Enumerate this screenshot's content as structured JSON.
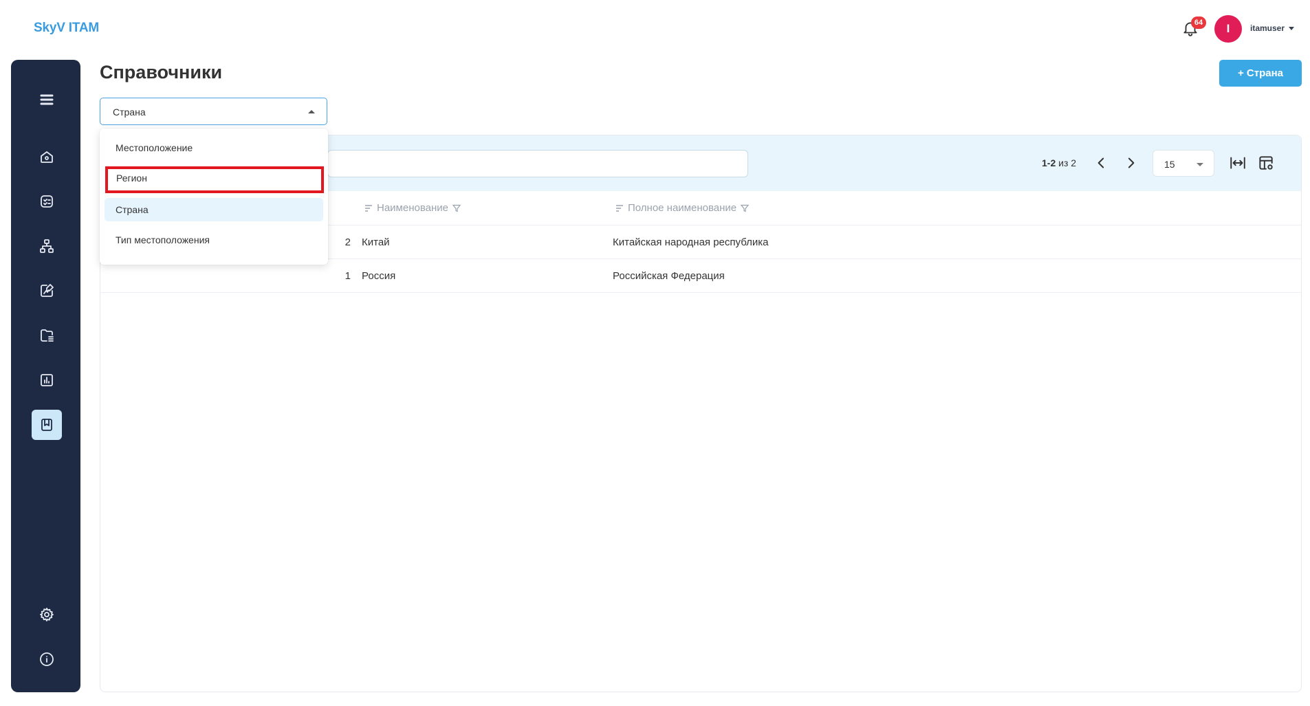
{
  "app": {
    "logo": "SkyV ITAM"
  },
  "header": {
    "notifications_count": "64",
    "avatar_initial": "I",
    "username": "itamuser"
  },
  "sidebar": {
    "items": [
      {
        "icon": "menu-icon"
      },
      {
        "icon": "home-icon"
      },
      {
        "icon": "checklist-icon"
      },
      {
        "icon": "hierarchy-icon"
      },
      {
        "icon": "chart-edit-icon"
      },
      {
        "icon": "folder-list-icon"
      },
      {
        "icon": "bar-chart-icon"
      },
      {
        "icon": "bookmark-icon",
        "active": true
      },
      {
        "icon": "gear-icon"
      },
      {
        "icon": "info-icon"
      }
    ]
  },
  "page": {
    "title": "Справочники",
    "add_button": "+ Страна"
  },
  "reference_select": {
    "value": "Страна",
    "options": [
      "Местоположение",
      "Регион",
      "Страна",
      "Тип местоположения"
    ],
    "selected_index": 2,
    "highlighted_index": 1
  },
  "table": {
    "pager": {
      "range": "1-2",
      "of_label": "из",
      "total": "2"
    },
    "page_size": "15",
    "columns": {
      "name": "Наименование",
      "full_name": "Полное наименование"
    },
    "rows": [
      {
        "id": "2",
        "name": "Китай",
        "full_name": "Китайская народная республика"
      },
      {
        "id": "1",
        "name": "Россия",
        "full_name": "Российская Федерация"
      }
    ]
  },
  "colors": {
    "accent": "#3aa8e4",
    "sidebar": "#1e2a44",
    "badge": "#e8383d",
    "avatar": "#e11d58",
    "highlight": "#e3171f"
  }
}
